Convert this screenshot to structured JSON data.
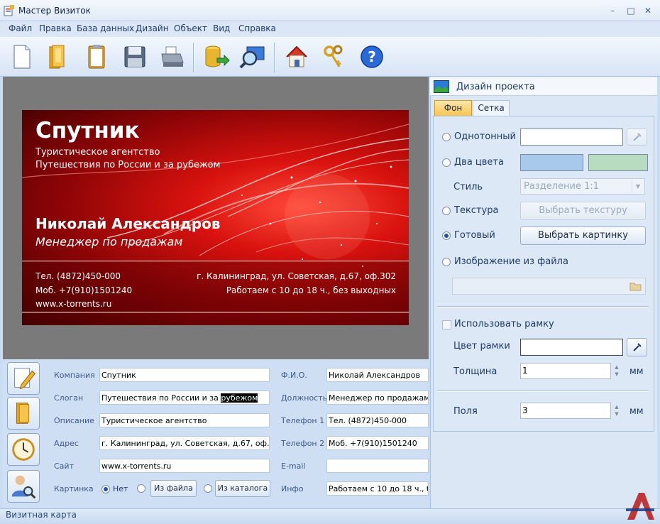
{
  "window": {
    "title": "Мастер Визиток",
    "controls": {
      "minimize": "–",
      "maximize": "□",
      "close": "✕"
    }
  },
  "menu": [
    "Файл",
    "Правка",
    "База данных",
    "Дизайн",
    "Объект",
    "Вид",
    "Справка"
  ],
  "toolbar": {
    "buttons": [
      "new-document",
      "open-folder",
      "clipboard",
      "save-disk",
      "printer",
      "database-export",
      "search-preview",
      "home",
      "keys",
      "help"
    ]
  },
  "card": {
    "company": "Спутник",
    "line1": "Туристическое агентство",
    "line2": "Путешествия по России и за рубежом",
    "name": "Николай Александров",
    "position": "Менеджер по продажам",
    "phone1": "Тел. (4872)450-000",
    "phone2": "Моб. +7(910)1501240",
    "site": "www.x-torrents.ru",
    "address": "г. Калининград, ул. Советская, д.67, оф.302",
    "hours": "Работаем с 10 до 18 ч., без выходных"
  },
  "form": {
    "labels": {
      "company": "Компания",
      "slogan": "Слоган",
      "description": "Описание",
      "address": "Адрес",
      "site": "Сайт",
      "picture": "Картинка",
      "fio": "Ф.И.О.",
      "position": "Должность",
      "phone1": "Телефон 1",
      "phone2": "Телефон 2",
      "email": "E-mail",
      "info": "Инфо"
    },
    "values": {
      "company": "Спутник",
      "slogan_pre": "Путешествия по России и за",
      "slogan_sel": "рубежом",
      "description": "Туристическое агентство",
      "address": "г. Калининград, ул. Советская, д.67, оф.302",
      "site": "www.x-torrents.ru",
      "fio": "Николай Александров",
      "position": "Менеджер по продажам",
      "phone1": "Тел. (4872)450-000",
      "phone2": "Моб. +7(910)1501240",
      "email": "",
      "info": "Работаем с 10 до 18 ч., без"
    },
    "picture_options": {
      "none": "Нет",
      "from_file": "Из файла",
      "from_catalog": "Из каталога",
      "selected": "none"
    }
  },
  "panel": {
    "title": "Дизайн проекта",
    "tabs": [
      "Фон",
      "Сетка"
    ],
    "active_tab": "Фон",
    "solid": "Однотонный",
    "two_colors": "Два цвета",
    "color_a": "#a8c8ec",
    "color_b": "#b8dcc0",
    "style_label": "Стиль",
    "style_value": "Разделение 1:1",
    "texture": "Текстура",
    "choose_texture": "Выбрать текстуру",
    "ready": "Готовый",
    "choose_picture": "Выбрать картинку",
    "from_file": "Изображение из файла",
    "selected_option": "ready",
    "use_frame": "Использовать рамку",
    "frame_color": "Цвет рамки",
    "thickness": "Толщина",
    "thickness_value": "1",
    "margins": "Поля",
    "margins_value": "3",
    "unit": "мм"
  },
  "status": {
    "text": "Визитная карта"
  }
}
